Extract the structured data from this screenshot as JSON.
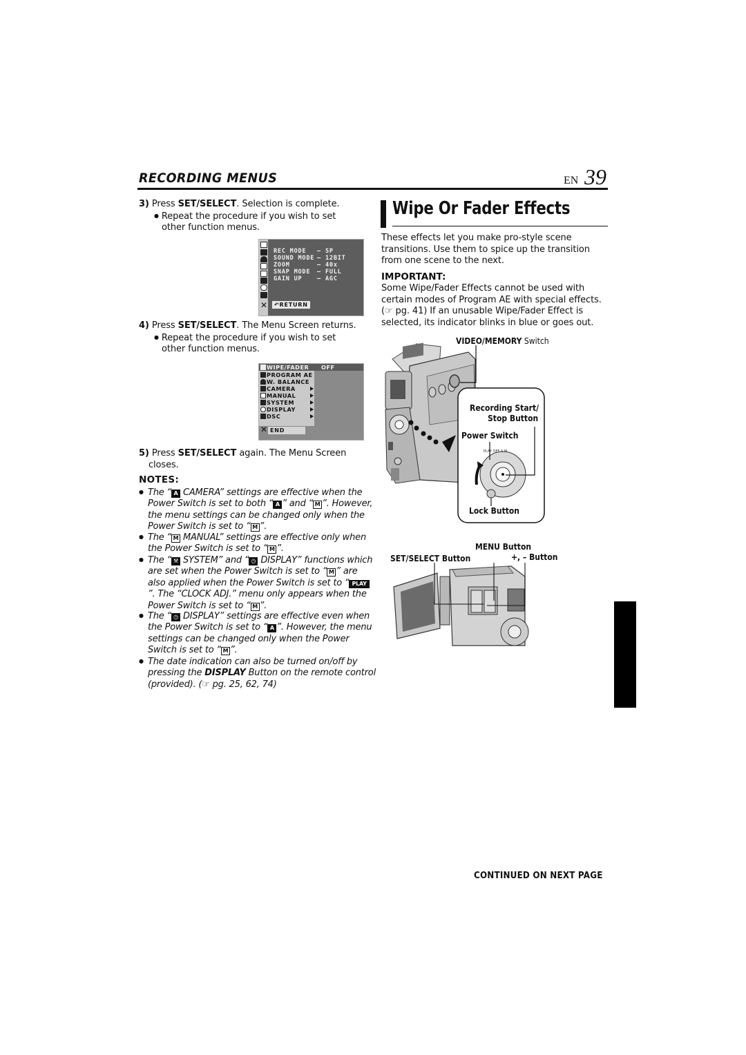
{
  "header": {
    "section_title": "RECORDING MENUS",
    "lang": "EN",
    "page_number": "39"
  },
  "left_column": {
    "step3": {
      "number": "3)",
      "text_pre": "Press ",
      "bold": "SET/SELECT",
      "text_post": ". Selection is complete.",
      "bullet": "Repeat the procedure if you wish to set other function menus."
    },
    "menu_screen_1": {
      "rows": [
        {
          "label": "REC MODE",
          "sep": "–",
          "value": "SP"
        },
        {
          "label": "SOUND MODE",
          "sep": "–",
          "value": "12BIT"
        },
        {
          "label": "ZOOM",
          "sep": "–",
          "value": "40x"
        },
        {
          "label": "SNAP MODE",
          "sep": "–",
          "value": "FULL"
        },
        {
          "label": "GAIN UP",
          "sep": "–",
          "value": "AGC"
        }
      ],
      "return_label": "RETURN",
      "icons": [
        "wipe-fader-icon",
        "program-ae-icon",
        "white-balance-icon",
        "camera-icon",
        "manual-icon",
        "system-icon",
        "display-icon",
        "dsc-icon"
      ]
    },
    "step4": {
      "number": "4)",
      "text_pre": "Press ",
      "bold": "SET/SELECT",
      "text_post": ". The Menu Screen returns.",
      "bullet": "Repeat the procedure if you wish to set other function menus."
    },
    "menu_screen_2": {
      "header_label": "WIPE/FADER",
      "header_value": "OFF",
      "items": [
        {
          "label": "PROGRAM AE",
          "submenu": false
        },
        {
          "label": "W. BALANCE",
          "submenu": false
        },
        {
          "label": "CAMERA",
          "submenu": true
        },
        {
          "label": "MANUAL",
          "submenu": true
        },
        {
          "label": "SYSTEM",
          "submenu": true
        },
        {
          "label": "DISPLAY",
          "submenu": true
        },
        {
          "label": "DSC",
          "submenu": true
        }
      ],
      "end_label": "END"
    },
    "step5": {
      "number": "5)",
      "text_pre": "Press ",
      "bold": "SET/SELECT",
      "text_post": " again. The Menu Screen closes."
    },
    "notes": {
      "heading": "NOTES:",
      "n1": {
        "a": "The “",
        "b": " CAMERA” settings are effective when the Power Switch is set to both “",
        "c": "” and “",
        "d": "”. However, the menu settings can be changed only when the Power Switch is set to “",
        "e": "”."
      },
      "n2": {
        "a": "The “",
        "b": " MANUAL” settings are effective only when the Power Switch is set to “",
        "c": "”."
      },
      "n3": {
        "a": "The “",
        "b": " SYSTEM” and “",
        "c": " DISPLAY” functions which are set when the Power Switch is set to “",
        "d": "” are also applied when the Power Switch is set to “",
        "e": "”. The “CLOCK ADJ.” menu only appears when the Power Switch is set to “",
        "f": "”."
      },
      "n4": {
        "a": "The “",
        "b": " DISPLAY” settings are effective even when the Power Switch is set to “",
        "c": "”. However, the menu settings can be changed only when the Power Switch is set to “",
        "d": "”."
      },
      "n5": {
        "a": "The date indication can also be turned on/off by pressing the ",
        "bold": "DISPLAY",
        "b": " Button on the remote control (provided). (☞ pg. 25, 62, 74)"
      },
      "chips": {
        "A": "A",
        "M": "M",
        "PLAY": "PLAY"
      }
    }
  },
  "right_column": {
    "section_title": "Wipe Or Fader Effects",
    "intro": "These effects let you make pro-style scene transitions. Use them to spice up the transition from one scene to the next.",
    "important_heading": "IMPORTANT:",
    "important_text": "Some Wipe/Fader Effects cannot be used with certain modes of Program AE with special effects. (☞ pg. 41) If an unusable Wipe/Fader Effect is selected, its indicator blinks in blue or goes out.",
    "diagram1_labels": {
      "video_memory_bold": "VIDEO/MEMORY",
      "video_memory_rest": " Switch",
      "rec_start": "Recording Start/",
      "stop_button": "Stop Button",
      "power_switch": "Power Switch",
      "lock_button": "Lock Button"
    },
    "diagram2_labels": {
      "menu_button": "MENU Button",
      "set_select_button": "SET/SELECT Button",
      "plus_minus_button": "+, – Button"
    },
    "continued": "CONTINUED ON NEXT PAGE"
  }
}
